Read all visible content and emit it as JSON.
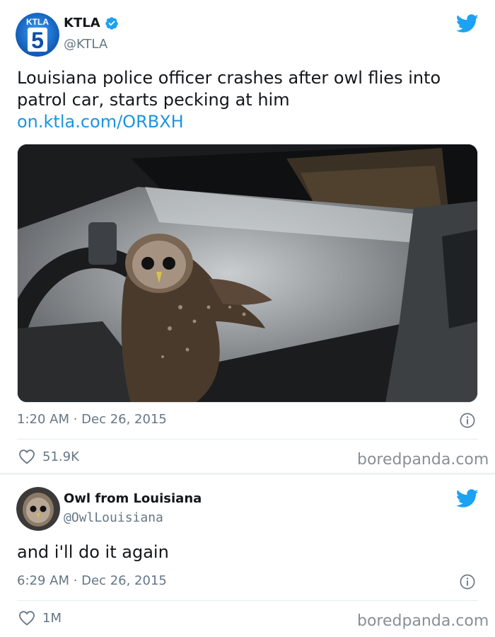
{
  "tweet1": {
    "author_name": "KTLA",
    "author_handle": "@KTLA",
    "text_line1": "Louisiana police officer crashes after owl flies into",
    "text_line2": "patrol car, starts pecking at him",
    "link": "on.ktla.com/ORBXH",
    "timestamp": "1:20 AM · Dec 26, 2015",
    "likes": "51.9K",
    "watermark": "boredpanda.com",
    "avatar_logo_text": "KTLA",
    "avatar_logo_number": "5"
  },
  "tweet2": {
    "author_name": "Owl from Louisiana",
    "author_handle": "@OwlLouisiana",
    "text": "and i'll do it again",
    "timestamp": "6:29 AM · Dec 26, 2015",
    "likes": "1M",
    "watermark": "boredpanda.com"
  },
  "colors": {
    "twitter_blue": "#1da1f2",
    "link_blue": "#1b95e0",
    "muted_gray": "#657786"
  },
  "icons": [
    "ktla-avatar-icon",
    "verified-badge-icon",
    "twitter-bird-icon",
    "info-icon",
    "heart-icon",
    "owl-avatar-icon"
  ]
}
